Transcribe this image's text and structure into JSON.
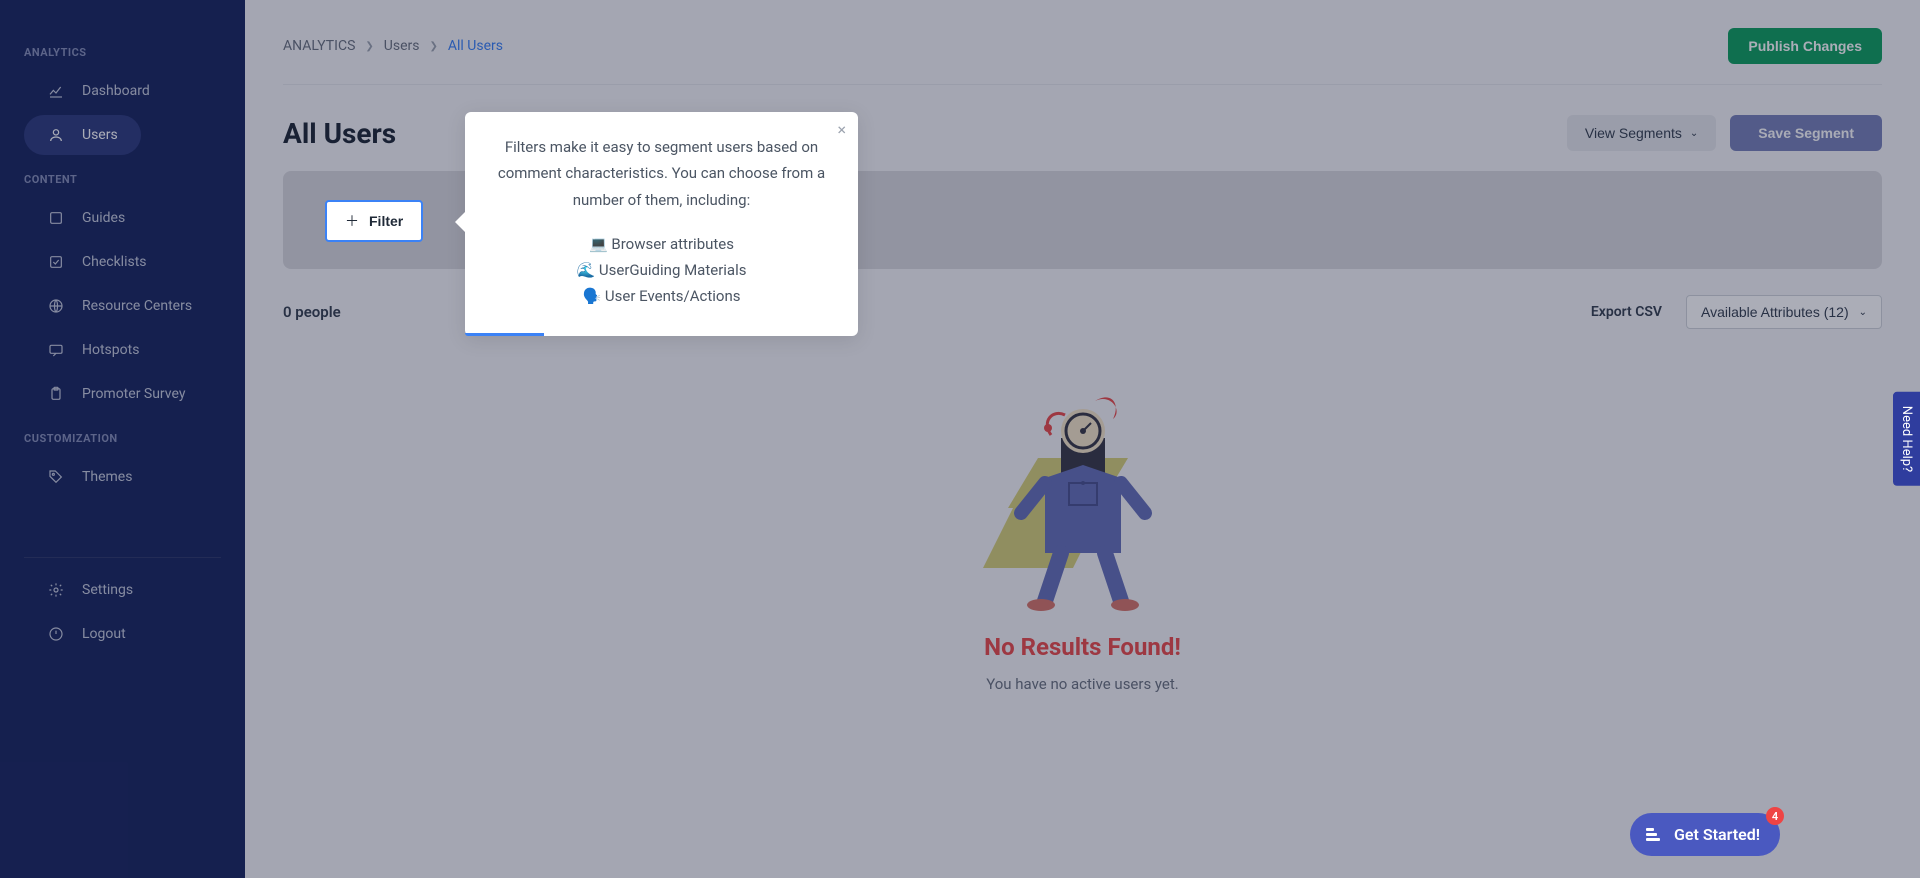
{
  "sidebar": {
    "sections": {
      "analytics": "ANALYTICS",
      "content": "CONTENT",
      "customization": "CUSTOMIZATION"
    },
    "items": {
      "dashboard": "Dashboard",
      "users": "Users",
      "guides": "Guides",
      "checklists": "Checklists",
      "resource_centers": "Resource Centers",
      "hotspots": "Hotspots",
      "promoter_survey": "Promoter Survey",
      "themes": "Themes",
      "settings": "Settings",
      "logout": "Logout"
    }
  },
  "breadcrumb": {
    "root": "ANALYTICS",
    "level1": "Users",
    "level2": "All Users"
  },
  "buttons": {
    "publish": "Publish Changes",
    "view_segments": "View Segments",
    "save_segment": "Save Segment",
    "filter": "Filter",
    "export_csv": "Export CSV",
    "attributes": "Available Attributes (12)",
    "get_started": "Get Started!"
  },
  "page": {
    "title": "All Users",
    "people_count": "0 people"
  },
  "empty": {
    "title": "No Results Found!",
    "sub": "You have no active users yet."
  },
  "tooltip": {
    "line1": "Filters make it easy to segment users based on comment characteristics. You can choose from a number of them, including:",
    "item1": "💻  Browser attributes",
    "item2": "🌊  UserGuiding Materials",
    "item3": "🗣️  User Events/Actions"
  },
  "help": {
    "tab": "Need Help?",
    "badge": "4"
  }
}
